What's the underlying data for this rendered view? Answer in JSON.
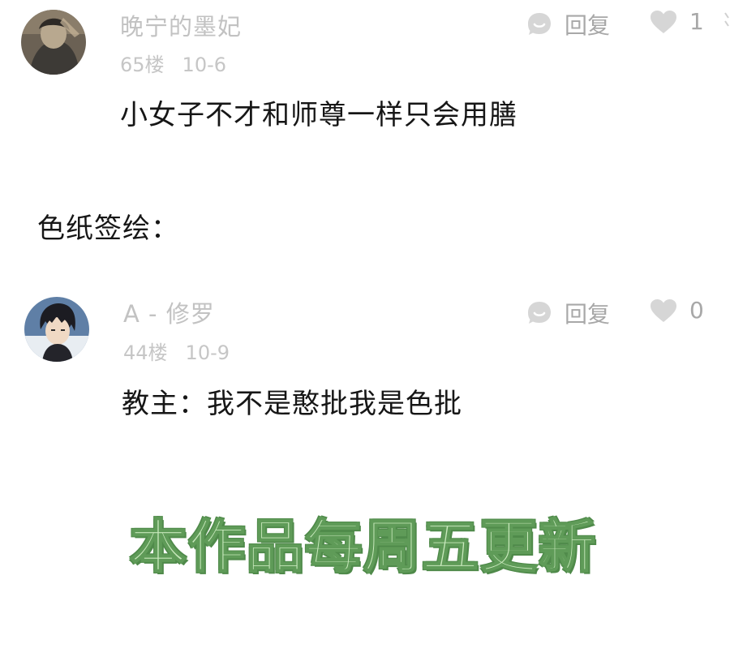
{
  "comments": [
    {
      "username": "晚宁的墨妃",
      "floor": "65楼",
      "date": "10-6",
      "reply_label": "回复",
      "like_count": "1",
      "text": "小女子不才和师尊一样只会用膳"
    },
    {
      "username": "A - 修罗",
      "floor": "44楼",
      "date": "10-9",
      "reply_label": "回复",
      "like_count": "0",
      "text": "教主：我不是憨批我是色批"
    }
  ],
  "section_label": "色纸签绘：",
  "banner_text": "本作品每周五更新",
  "icons": {
    "reply": "reply-bubble-icon",
    "like": "heart-icon"
  },
  "colors": {
    "muted_text": "#c2c2c2",
    "action_text": "#a8a8a8",
    "icon_fill": "#d6d6d6",
    "banner_fill": "#c9e9bd",
    "banner_outline": "#4f8a4a"
  }
}
